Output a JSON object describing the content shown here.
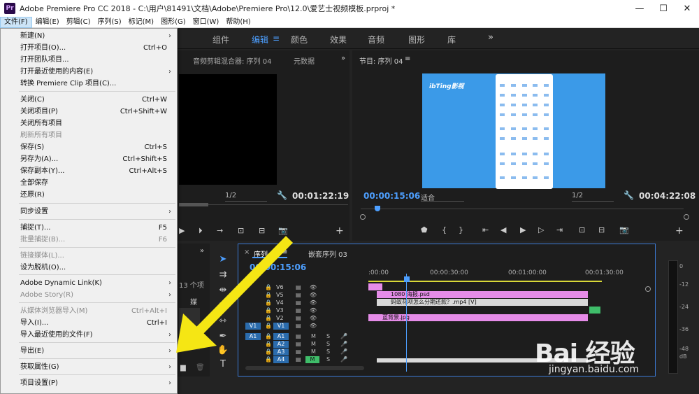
{
  "window": {
    "app_icon": "Pr",
    "title": "Adobe Premiere Pro CC 2018 - C:\\用户\\81491\\文档\\Adobe\\Premiere Pro\\12.0\\爱艺士视频模板.prproj *",
    "minimize": "—",
    "maximize": "☐",
    "close": "✕"
  },
  "menubar": {
    "items": [
      "文件(F)",
      "编辑(E)",
      "剪辑(C)",
      "序列(S)",
      "标记(M)",
      "图形(G)",
      "窗口(W)",
      "帮助(H)"
    ]
  },
  "workspaces": {
    "tabs": [
      "组件",
      "编辑",
      "颜色",
      "效果",
      "音频",
      "图形",
      "库"
    ],
    "active_index": 1,
    "menu_glyph": "≡",
    "more_glyph": "»"
  },
  "source_panel": {
    "tabs": [
      "音频剪辑混合器: 序列 04",
      "元数据"
    ],
    "more_glyph": "»",
    "zoom": "1/2",
    "timecode": "00:01:22:19"
  },
  "program_panel": {
    "title": "节目: 序列 04",
    "menu_glyph": "≡",
    "video_logo": "ibTing影视",
    "timecode_current": "00:00:15:06",
    "fit_dropdown": "适合",
    "zoom": "1/2",
    "timecode_total": "00:04:22:08"
  },
  "project_panel": {
    "more_glyph": "»",
    "items_count_fragment": "13 个项",
    "media_fragment": "媒"
  },
  "timeline": {
    "close_glyph": "×",
    "tab_active": "序列 04",
    "tab_menu_glyph": "≡",
    "tab_other": "嵌套序列 03",
    "timecode": "00:00:15:06",
    "ruler_labels": [
      ":00:00",
      "00:00:30:00",
      "00:01:00:00",
      "00:01:30:00"
    ],
    "tracks": [
      {
        "name": "V6"
      },
      {
        "name": "V5"
      },
      {
        "name": "V4"
      },
      {
        "name": "V3"
      },
      {
        "name": "V2"
      },
      {
        "name": "V1"
      },
      {
        "name": "A1"
      },
      {
        "name": "A2"
      },
      {
        "name": "A3"
      },
      {
        "name": "A4"
      }
    ],
    "target_v": "V1",
    "target_a": "A1",
    "mute_label": "M",
    "solo_label": "S",
    "clips": {
      "psd": "1080 海报.psd",
      "mp4": "蚂蚁花呗怎么分期还款？.mp4 [V]",
      "jpg": "蓝背景.jpg"
    }
  },
  "meter": {
    "labels": [
      "0",
      "-12",
      "-24",
      "-36",
      "-48",
      "dB"
    ]
  },
  "file_menu": {
    "items": [
      {
        "label": "新建(N)",
        "shortcut": "",
        "submenu": true,
        "disabled": false
      },
      {
        "label": "打开项目(O)...",
        "shortcut": "Ctrl+O",
        "submenu": false,
        "disabled": false
      },
      {
        "label": "打开团队项目...",
        "shortcut": "",
        "submenu": false,
        "disabled": false
      },
      {
        "label": "打开最近使用的内容(E)",
        "shortcut": "",
        "submenu": true,
        "disabled": false
      },
      {
        "label": "转换 Premiere Clip 项目(C)...",
        "shortcut": "",
        "submenu": false,
        "disabled": false
      },
      {
        "label": "关闭(C)",
        "shortcut": "Ctrl+W",
        "submenu": false,
        "disabled": false
      },
      {
        "label": "关闭项目(P)",
        "shortcut": "Ctrl+Shift+W",
        "submenu": false,
        "disabled": false
      },
      {
        "label": "关闭所有项目",
        "shortcut": "",
        "submenu": false,
        "disabled": false
      },
      {
        "label": "刷新所有项目",
        "shortcut": "",
        "submenu": false,
        "disabled": true
      },
      {
        "label": "保存(S)",
        "shortcut": "Ctrl+S",
        "submenu": false,
        "disabled": false
      },
      {
        "label": "另存为(A)...",
        "shortcut": "Ctrl+Shift+S",
        "submenu": false,
        "disabled": false
      },
      {
        "label": "保存副本(Y)...",
        "shortcut": "Ctrl+Alt+S",
        "submenu": false,
        "disabled": false
      },
      {
        "label": "全部保存",
        "shortcut": "",
        "submenu": false,
        "disabled": false
      },
      {
        "label": "还原(R)",
        "shortcut": "",
        "submenu": false,
        "disabled": false
      },
      {
        "label": "同步设置",
        "shortcut": "",
        "submenu": true,
        "disabled": false
      },
      {
        "label": "捕捉(T)...",
        "shortcut": "F5",
        "submenu": false,
        "disabled": false
      },
      {
        "label": "批量捕捉(B)...",
        "shortcut": "F6",
        "submenu": false,
        "disabled": true
      },
      {
        "label": "链接媒体(L)...",
        "shortcut": "",
        "submenu": false,
        "disabled": true
      },
      {
        "label": "设为脱机(O)...",
        "shortcut": "",
        "submenu": false,
        "disabled": false
      },
      {
        "label": "Adobe Dynamic Link(K)",
        "shortcut": "",
        "submenu": true,
        "disabled": false
      },
      {
        "label": "Adobe Story(R)",
        "shortcut": "",
        "submenu": true,
        "disabled": true
      },
      {
        "label": "从媒体浏览器导入(M)",
        "shortcut": "Ctrl+Alt+I",
        "submenu": false,
        "disabled": true
      },
      {
        "label": "导入(I)...",
        "shortcut": "Ctrl+I",
        "submenu": false,
        "disabled": false
      },
      {
        "label": "导入最近使用的文件(F)",
        "shortcut": "",
        "submenu": true,
        "disabled": false
      },
      {
        "label": "导出(E)",
        "shortcut": "",
        "submenu": true,
        "disabled": false
      },
      {
        "label": "获取属性(G)",
        "shortcut": "",
        "submenu": true,
        "disabled": false
      },
      {
        "label": "项目设置(P)",
        "shortcut": "",
        "submenu": true,
        "disabled": false
      }
    ],
    "submenu_glyph": "›"
  },
  "watermark": {
    "brand": "Bai 经验",
    "url": "jingyan.baidu.com"
  },
  "colors": {
    "accent_blue": "#4d9fff",
    "arrow_yellow": "#f5e614",
    "clip_pink": "#e58ce8",
    "video_blue": "#3b9ae8"
  }
}
